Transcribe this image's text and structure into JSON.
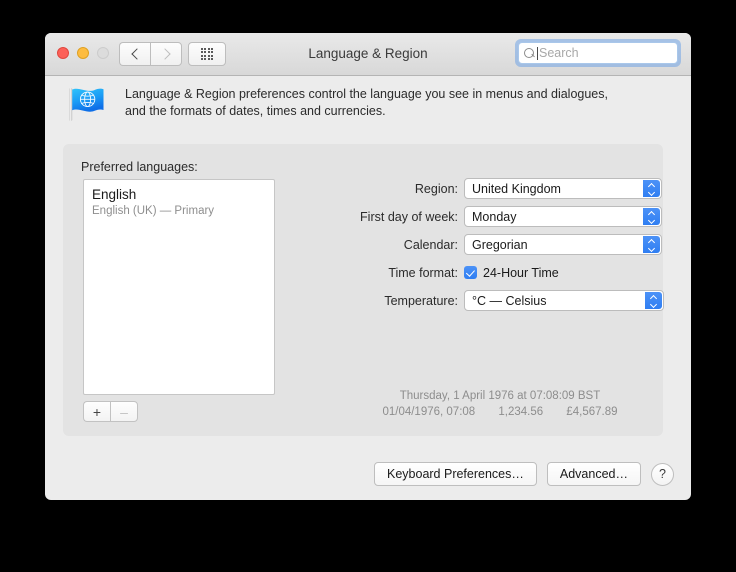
{
  "window": {
    "title": "Language & Region",
    "traffic_lights": [
      "close",
      "minimize",
      "zoom-disabled"
    ]
  },
  "toolbar": {
    "back_icon": "chevron-left-icon",
    "forward_icon": "chevron-right-icon",
    "grid_icon": "show-all-grid-icon",
    "search": {
      "placeholder": "Search",
      "value": "",
      "icon": "search-icon"
    }
  },
  "banner": {
    "icon": "language-region-flag-globe-icon",
    "line1": "Language & Region preferences control the language you see in menus and dialogues,",
    "line2": "and the formats of dates, times and currencies."
  },
  "languages": {
    "label": "Preferred languages:",
    "items": [
      {
        "name": "English",
        "detail": "English (UK) — Primary"
      }
    ],
    "add_label": "+",
    "remove_label": "–"
  },
  "settings": {
    "rows": [
      {
        "label": "Region:",
        "value": "United Kingdom",
        "type": "popup"
      },
      {
        "label": "First day of week:",
        "value": "Monday",
        "type": "popup"
      },
      {
        "label": "Calendar:",
        "value": "Gregorian",
        "type": "popup"
      },
      {
        "label": "Time format:",
        "value": "24-Hour Time",
        "type": "checkbox",
        "checked": true
      },
      {
        "label": "Temperature:",
        "value": "°C — Celsius",
        "type": "popup"
      }
    ]
  },
  "preview": {
    "line1": "Thursday, 1 April 1976 at 07:08:09 BST",
    "date_short": "01/04/1976, 07:08",
    "number": "1,234.56",
    "currency": "£4,567.89"
  },
  "footer": {
    "keyboard_prefs": "Keyboard Preferences…",
    "advanced": "Advanced…",
    "help": "?"
  },
  "colors": {
    "accent": "#2f7ef2",
    "window_bg": "#ececec",
    "group_bg": "#e3e3e3"
  }
}
